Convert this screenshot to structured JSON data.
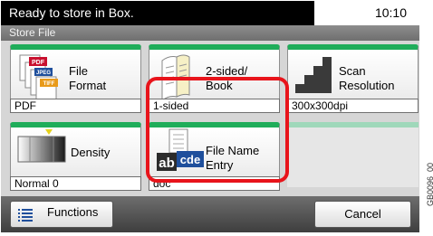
{
  "status_bar": {
    "message": "Ready to store in Box.",
    "time": "10:10"
  },
  "title_bar": {
    "title": "Store File"
  },
  "tiles": [
    {
      "label": "File\nFormat",
      "value": "PDF",
      "icon": "file-format-icon"
    },
    {
      "label": "2-sided/\nBook",
      "value": "1-sided",
      "icon": "two-sided-book-icon"
    },
    {
      "label": "Scan\nResolution",
      "value": "300x300dpi",
      "icon": "scan-resolution-icon"
    },
    {
      "label": "Density",
      "value": "Normal 0",
      "icon": "density-icon"
    },
    {
      "label": "File Name\nEntry",
      "value": "doc",
      "icon": "file-name-entry-icon"
    }
  ],
  "icon_text": {
    "pdf": "PDF",
    "jpeg": "JPEG",
    "tiff": "TIFF",
    "entry_ab": "ab",
    "entry_cde": "cde"
  },
  "bottom_bar": {
    "functions_label": "Functions",
    "cancel_label": "Cancel"
  },
  "watermark": "GB0096_00",
  "colors": {
    "tile_accent": "#1fad5a",
    "highlight": "#e8141b",
    "icon_blue": "#1f4f9c",
    "icon_red": "#c8102e"
  }
}
